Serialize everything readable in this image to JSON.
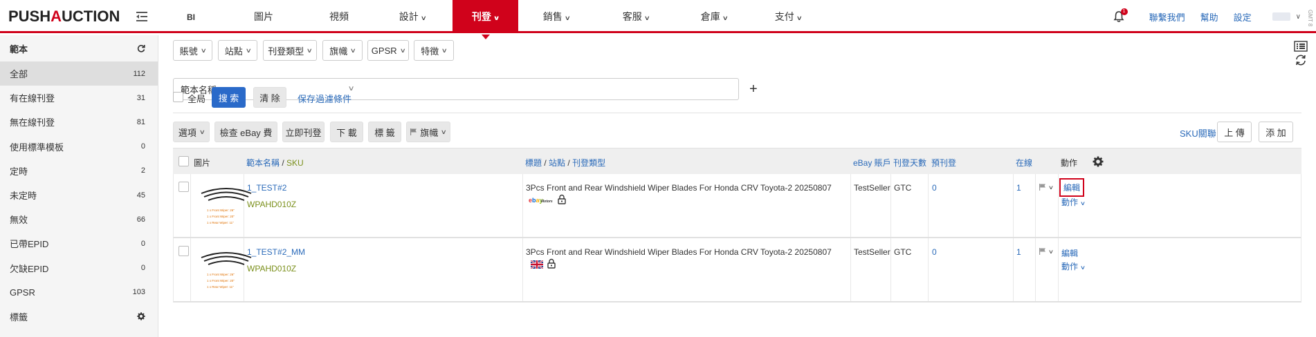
{
  "app": {
    "logo_a": "PUSH",
    "logo_b": "A",
    "logo_c": "UCTION"
  },
  "nav": {
    "items": [
      {
        "label": "BI",
        "chev": false
      },
      {
        "label": "圖片",
        "chev": false
      },
      {
        "label": "視頻",
        "chev": false
      },
      {
        "label": "設計",
        "chev": true
      },
      {
        "label": "刊登",
        "chev": true,
        "active": true
      },
      {
        "label": "銷售",
        "chev": true
      },
      {
        "label": "客服",
        "chev": true
      },
      {
        "label": "倉庫",
        "chev": true
      },
      {
        "label": "支付",
        "chev": true
      }
    ],
    "bell_badge": "1",
    "contact": "聯繫我們",
    "help": "幫助",
    "settings": "設定",
    "gmt": "GMT 8"
  },
  "sidebar": {
    "title": "範本",
    "items": [
      {
        "label": "全部",
        "count": "112",
        "active": true
      },
      {
        "label": "有在線刊登",
        "count": "31"
      },
      {
        "label": "無在線刊登",
        "count": "81"
      },
      {
        "label": "使用標準模板",
        "count": "0"
      },
      {
        "label": "定時",
        "count": "2"
      },
      {
        "label": "未定時",
        "count": "45"
      },
      {
        "label": "無效",
        "count": "66"
      },
      {
        "label": "已帶EPID",
        "count": "0"
      },
      {
        "label": "欠缺EPID",
        "count": "0"
      },
      {
        "label": "GPSR",
        "count": "103"
      },
      {
        "label": "標籤",
        "count": ""
      }
    ]
  },
  "filters": {
    "account": "賬號",
    "site": "站點",
    "listing_type": "刊登類型",
    "flag": "旗幟",
    "gpsr": "GPSR",
    "feature": "特徵",
    "search_field": "範本名稱",
    "search_value": "",
    "global": "全局",
    "search_btn": "搜 索",
    "clear_btn": "清 除",
    "save_filter": "保存過濾條件"
  },
  "toolbar": {
    "options": "選項",
    "check_fee": "檢查 eBay 費",
    "list_now": "立即刊登",
    "download": "下 載",
    "tag": "標 籤",
    "flag": "旗幟",
    "sku_link": "SKU關聯",
    "upload": "上 傳",
    "add": "添 加"
  },
  "table": {
    "headers": {
      "image": "圖片",
      "name": "範本名稱",
      "sep": "/",
      "sku": "SKU",
      "title": "標題",
      "site": "站點",
      "ltype": "刊登類型",
      "account": "eBay 賬戶",
      "days": "刊登天數",
      "pre": "預刊登",
      "online": "在線",
      "action": "動作"
    },
    "rows": [
      {
        "name": "1_TEST#2",
        "sku": "WPAHD010Z",
        "title": "3Pcs Front and Rear Windshield Wiper Blades For Honda CRV Toyota-2 20250807",
        "site_logo": "ebay-motors-logo",
        "account": "TestSeller",
        "days": "GTC",
        "pre": "0",
        "online": "1",
        "edit": "編輯",
        "action": "動作",
        "highlight": true
      },
      {
        "name": "1_TEST#2_MM",
        "sku": "WPAHD010Z",
        "title": "3Pcs Front and Rear Windshield Wiper Blades For Honda CRV Toyota-2 20250807",
        "site_logo": "uk-flag",
        "account": "TestSeller",
        "days": "GTC",
        "pre": "0",
        "online": "1",
        "edit": "編輯",
        "action": "動作",
        "highlight": false
      }
    ],
    "thumb_lines": [
      "1 x Front Wiper: 26\"",
      "1 x Front Wiper: 20\"",
      "1 x Rear Wiper: 11\""
    ]
  },
  "colors": {
    "brand": "#d0021b",
    "link": "#2a6ab9",
    "primary": "#2a6ac9",
    "sku": "#7a8f1a"
  }
}
